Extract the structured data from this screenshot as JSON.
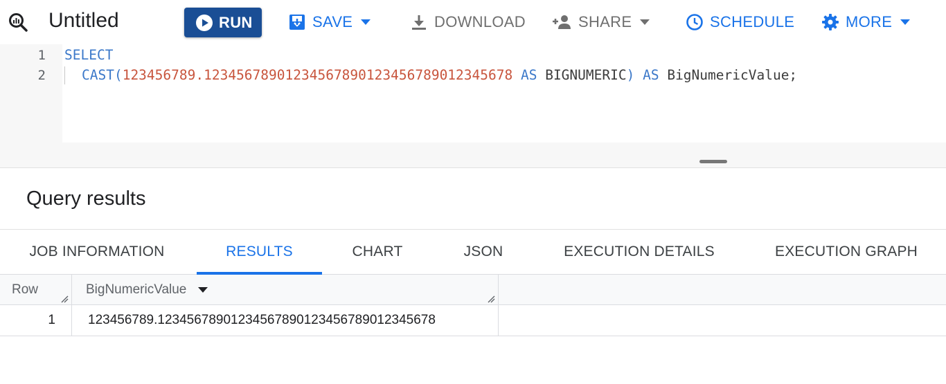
{
  "toolbar": {
    "title": "Untitled",
    "run_label": "RUN",
    "save_label": "SAVE",
    "download_label": "DOWNLOAD",
    "share_label": "SHARE",
    "schedule_label": "SCHEDULE",
    "more_label": "MORE"
  },
  "editor": {
    "line_numbers": [
      "1",
      "2"
    ],
    "line1": {
      "kw": "SELECT"
    },
    "line2": {
      "cast": "CAST(",
      "number": "123456789.12345678901234567890123456789012345678",
      "as1": " AS ",
      "type": "BIGNUMERIC",
      "paren": ")",
      "as2": " AS ",
      "alias": "BigNumericValue;"
    }
  },
  "results": {
    "title": "Query results",
    "tabs": [
      {
        "label": "JOB INFORMATION"
      },
      {
        "label": "RESULTS"
      },
      {
        "label": "CHART"
      },
      {
        "label": "JSON"
      },
      {
        "label": "EXECUTION DETAILS"
      },
      {
        "label": "EXECUTION GRAPH"
      }
    ],
    "columns": [
      "Row",
      "BigNumericValue"
    ],
    "rows": [
      {
        "row": "1",
        "value": "123456789.12345678901234567890123456789012345678"
      }
    ]
  },
  "colors": {
    "run_button": "#1a4e95",
    "accent": "#1a73e8",
    "keyword": "#3b78c9",
    "number": "#c8553d"
  }
}
